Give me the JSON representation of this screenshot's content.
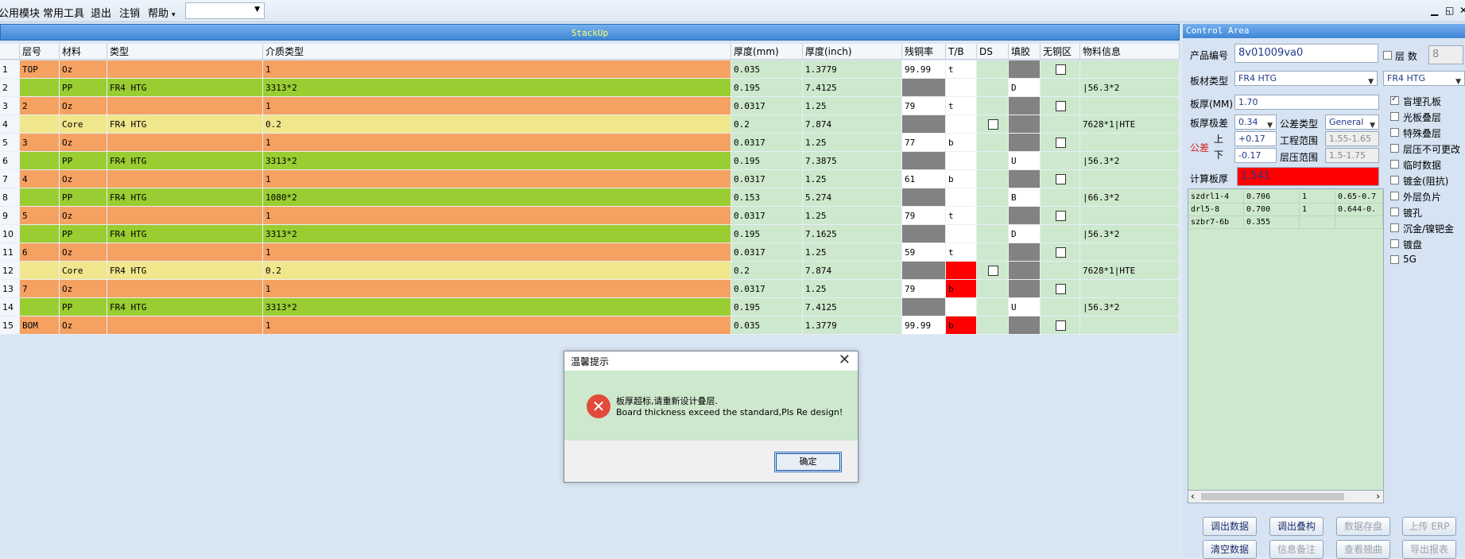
{
  "menu": {
    "items": [
      "公用模块",
      "常用工具",
      "退出",
      "注销",
      "帮助"
    ],
    "help_arrow": "▾",
    "combo_value": ""
  },
  "window_controls": {
    "minimize": "▁",
    "restore": "◱",
    "close": "✕"
  },
  "stackup": {
    "title": "StackUp",
    "headers": [
      "层号",
      "材料",
      "类型",
      "介质类型",
      "厚度(mm)",
      "厚度(inch)",
      "残铜率",
      "T/B",
      "DS",
      "填胶",
      "无铜区",
      "物料信息"
    ],
    "rows": [
      {
        "num": "1",
        "layer": "TOP",
        "material": "Oz",
        "type": "",
        "dielectric": "1",
        "th_mm": "0.035",
        "th_inch": "1.3779",
        "copper": "99.99",
        "tb": "t",
        "fill": "",
        "info": "",
        "kind": "oz",
        "copper_cell": "white",
        "tb_cell": "white",
        "ds_check": false,
        "fill_cell": "gray",
        "nocopper_check": true
      },
      {
        "num": "2",
        "layer": "",
        "material": "PP",
        "type": "FR4 HTG",
        "dielectric": "3313*2",
        "th_mm": "0.195",
        "th_inch": "7.4125",
        "copper": "",
        "tb": "",
        "fill": "D",
        "info": "|56.3*2",
        "kind": "pp",
        "copper_cell": "gray",
        "tb_cell": "white",
        "ds_check": false,
        "fill_cell": "white",
        "nocopper_check": false
      },
      {
        "num": "3",
        "layer": "2",
        "material": "Oz",
        "type": "",
        "dielectric": "1",
        "th_mm": "0.0317",
        "th_inch": "1.25",
        "copper": "79",
        "tb": "t",
        "fill": "",
        "info": "",
        "kind": "oz",
        "copper_cell": "white",
        "tb_cell": "white",
        "ds_check": false,
        "fill_cell": "gray",
        "nocopper_check": true
      },
      {
        "num": "4",
        "layer": "",
        "material": "Core",
        "type": "FR4 HTG",
        "dielectric": "0.2",
        "th_mm": "0.2",
        "th_inch": "7.874",
        "copper": "",
        "tb": "",
        "fill": "",
        "info": "7628*1|HTE",
        "kind": "core",
        "copper_cell": "gray",
        "tb_cell": "white",
        "ds_check": true,
        "fill_cell": "gray",
        "nocopper_check": false
      },
      {
        "num": "5",
        "layer": "3",
        "material": "Oz",
        "type": "",
        "dielectric": "1",
        "th_mm": "0.0317",
        "th_inch": "1.25",
        "copper": "77",
        "tb": "b",
        "fill": "",
        "info": "",
        "kind": "oz",
        "copper_cell": "white",
        "tb_cell": "white",
        "ds_check": false,
        "fill_cell": "gray",
        "nocopper_check": true
      },
      {
        "num": "6",
        "layer": "",
        "material": "PP",
        "type": "FR4 HTG",
        "dielectric": "3313*2",
        "th_mm": "0.195",
        "th_inch": "7.3875",
        "copper": "",
        "tb": "",
        "fill": "U",
        "info": "|56.3*2",
        "kind": "pp",
        "copper_cell": "gray",
        "tb_cell": "white",
        "ds_check": false,
        "fill_cell": "white",
        "nocopper_check": false
      },
      {
        "num": "7",
        "layer": "4",
        "material": "Oz",
        "type": "",
        "dielectric": "1",
        "th_mm": "0.0317",
        "th_inch": "1.25",
        "copper": "61",
        "tb": "b",
        "fill": "",
        "info": "",
        "kind": "oz",
        "copper_cell": "white",
        "tb_cell": "white",
        "ds_check": false,
        "fill_cell": "gray",
        "nocopper_check": true
      },
      {
        "num": "8",
        "layer": "",
        "material": "PP",
        "type": "FR4 HTG",
        "dielectric": "1080*2",
        "th_mm": "0.153",
        "th_inch": "5.274",
        "copper": "",
        "tb": "",
        "fill": "B",
        "info": "|66.3*2",
        "kind": "pp",
        "copper_cell": "gray",
        "tb_cell": "white",
        "ds_check": false,
        "fill_cell": "white",
        "nocopper_check": false
      },
      {
        "num": "9",
        "layer": "5",
        "material": "Oz",
        "type": "",
        "dielectric": "1",
        "th_mm": "0.0317",
        "th_inch": "1.25",
        "copper": "79",
        "tb": "t",
        "fill": "",
        "info": "",
        "kind": "oz",
        "copper_cell": "white",
        "tb_cell": "white",
        "ds_check": false,
        "fill_cell": "gray",
        "nocopper_check": true
      },
      {
        "num": "10",
        "layer": "",
        "material": "PP",
        "type": "FR4 HTG",
        "dielectric": "3313*2",
        "th_mm": "0.195",
        "th_inch": "7.1625",
        "copper": "",
        "tb": "",
        "fill": "D",
        "info": "|56.3*2",
        "kind": "pp",
        "copper_cell": "gray",
        "tb_cell": "white",
        "ds_check": false,
        "fill_cell": "white",
        "nocopper_check": false
      },
      {
        "num": "11",
        "layer": "6",
        "material": "Oz",
        "type": "",
        "dielectric": "1",
        "th_mm": "0.0317",
        "th_inch": "1.25",
        "copper": "59",
        "tb": "t",
        "fill": "",
        "info": "",
        "kind": "oz",
        "copper_cell": "white",
        "tb_cell": "white",
        "ds_check": false,
        "fill_cell": "gray",
        "nocopper_check": true
      },
      {
        "num": "12",
        "layer": "",
        "material": "Core",
        "type": "FR4 HTG",
        "dielectric": "0.2",
        "th_mm": "0.2",
        "th_inch": "7.874",
        "copper": "",
        "tb": "",
        "fill": "",
        "info": "7628*1|HTE",
        "kind": "core",
        "copper_cell": "gray",
        "tb_cell": "red",
        "ds_check": true,
        "fill_cell": "gray",
        "nocopper_check": false
      },
      {
        "num": "13",
        "layer": "7",
        "material": "Oz",
        "type": "",
        "dielectric": "1",
        "th_mm": "0.0317",
        "th_inch": "1.25",
        "copper": "79",
        "tb": "b",
        "fill": "",
        "info": "",
        "kind": "oz",
        "copper_cell": "white",
        "tb_cell": "red",
        "ds_check": false,
        "fill_cell": "gray",
        "nocopper_check": true
      },
      {
        "num": "14",
        "layer": "",
        "material": "PP",
        "type": "FR4 HTG",
        "dielectric": "3313*2",
        "th_mm": "0.195",
        "th_inch": "7.4125",
        "copper": "",
        "tb": "",
        "fill": "U",
        "info": "|56.3*2",
        "kind": "pp",
        "copper_cell": "gray",
        "tb_cell": "white",
        "ds_check": false,
        "fill_cell": "white",
        "nocopper_check": false
      },
      {
        "num": "15",
        "layer": "BOM",
        "material": "Oz",
        "type": "",
        "dielectric": "1",
        "th_mm": "0.035",
        "th_inch": "1.3779",
        "copper": "99.99",
        "tb": "b",
        "fill": "",
        "info": "",
        "kind": "oz",
        "copper_cell": "white",
        "tb_cell": "red",
        "ds_check": false,
        "fill_cell": "gray",
        "nocopper_check": true
      }
    ]
  },
  "control": {
    "title": "Control Area",
    "product_no_label": "产品编号",
    "product_no_value": "8v01009va0",
    "layers_label": "层 数",
    "layers_value": "8",
    "board_type_label": "板材类型",
    "board_type_value": "FR4 HTG",
    "board_type_value2": "FR4 HTG",
    "thickness_label": "板厚(MM)",
    "thickness_value": "1.70",
    "thk_tol_label": "板厚极差",
    "thk_tol_value": "0.34",
    "tol_type_label": "公差类型",
    "tol_type_value": "General",
    "tol_label": "公差",
    "upper_label": "上",
    "upper_value": "+0.17",
    "lower_label": "下",
    "lower_value": "-0.17",
    "eng_range_label": "工程范围",
    "eng_range_value": "1.55-1.65",
    "press_range_label": "层压范围",
    "press_range_value": "1.5-1.75",
    "calc_label": "计算板厚",
    "calc_value": "1.541",
    "subgrid": [
      [
        "szdrl1-4",
        "0.706",
        "1",
        "0.65-0.7"
      ],
      [
        "drl5-8",
        "0.700",
        "1",
        "0.644-0."
      ],
      [
        "szbr7-6b",
        "0.355",
        "",
        ""
      ]
    ],
    "options": [
      {
        "label": "盲埋孔板",
        "checked": true
      },
      {
        "label": "光板叠层",
        "checked": false
      },
      {
        "label": "特殊叠层",
        "checked": false
      },
      {
        "label": "层压不可更改",
        "checked": false
      },
      {
        "label": "临时数据",
        "checked": false
      },
      {
        "label": "镀金(阻抗)",
        "checked": false
      },
      {
        "label": "外层负片",
        "checked": false
      },
      {
        "label": "镀孔",
        "checked": false
      },
      {
        "label": "沉金/镍钯金",
        "checked": false
      },
      {
        "label": "镀盘",
        "checked": false
      },
      {
        "label": "5G",
        "checked": false
      }
    ],
    "buttons": {
      "load_data": "调出数据",
      "load_stack": "调出叠构",
      "save_data": "数据存盘",
      "upload_erp": "上传 ERP",
      "clear_data": "清空数据",
      "info_note": "信息备注",
      "view_history": "查看翘曲",
      "export_report": "导出报表"
    },
    "scroll_left": "‹",
    "scroll_right": "›"
  },
  "dialog": {
    "title": "温馨提示",
    "close_glyph": "✕",
    "icon": "error-icon",
    "message_cn": "板厚超标,请重新设计叠层.",
    "message_en": "Board thickness exceed the standard,Pls Re design!",
    "ok_label": "确定"
  }
}
